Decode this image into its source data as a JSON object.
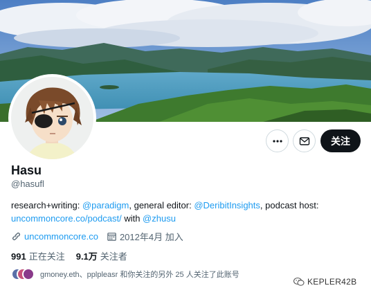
{
  "profile": {
    "display_name": "Hasu",
    "handle": "@hasufl",
    "follow_label": "关注",
    "more_icon": "ellipsis-icon",
    "message_icon": "envelope-icon"
  },
  "bio": {
    "text_1": "research+writing: ",
    "mention_1": "@paradigm",
    "text_2": ", general editor: ",
    "mention_2": "@DeribitInsights",
    "text_3": ", podcast host: ",
    "link_1": "uncommoncore.co/podcast/",
    "text_4": " with ",
    "mention_3": "@zhusu"
  },
  "meta": {
    "website": "uncommoncore.co",
    "joined": "2012年4月 加入",
    "link_icon": "link-icon",
    "calendar_icon": "calendar-icon"
  },
  "counts": {
    "following_value": "991",
    "following_label": "正在关注",
    "followers_value": "9.1万",
    "followers_label": "关注者"
  },
  "followed_by": {
    "text": "gmoney.eth、pplpleasr 和你关注的另外 25 人关注了此账号"
  },
  "watermark": {
    "text": "KEPLER42B",
    "icon": "wechat-icon"
  },
  "colors": {
    "link": "#1d9bf0",
    "text_primary": "#0f1419",
    "text_secondary": "#536471",
    "follow_button_bg": "#0f1419"
  }
}
